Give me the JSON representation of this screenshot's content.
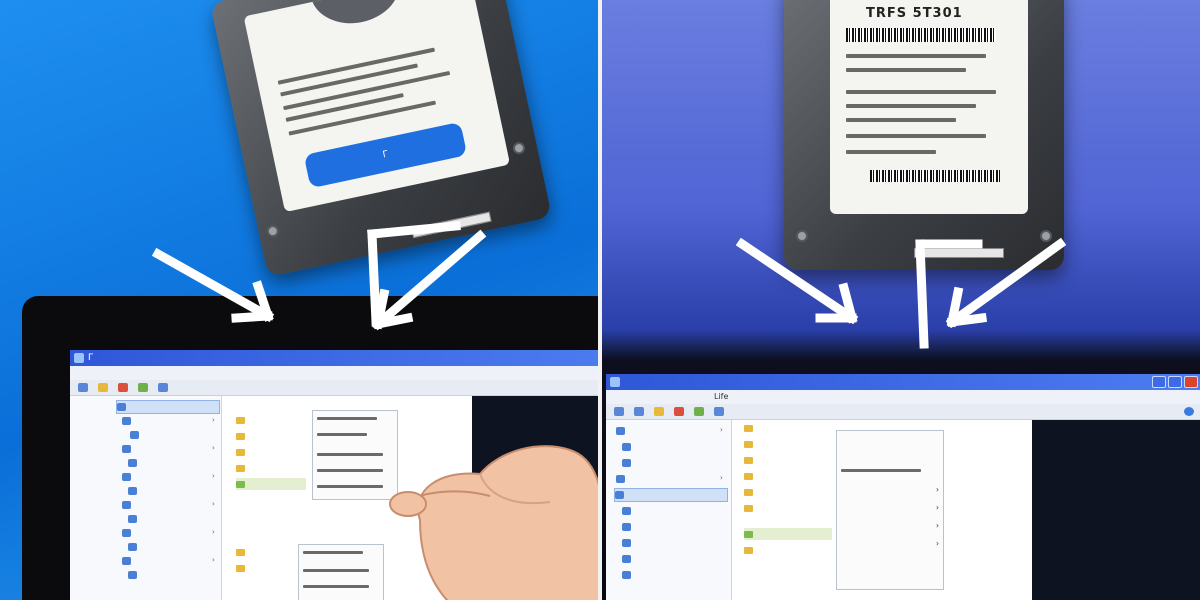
{
  "left_panel": {
    "drive": {
      "label_title": "",
      "button_text": "Γ"
    },
    "window": {
      "title": "Γ",
      "menu": [
        "",
        "",
        "",
        "",
        "",
        ""
      ],
      "nav_items": [
        "",
        "",
        "",
        "",
        "",
        "",
        "",
        "",
        "",
        "",
        "",
        "",
        ""
      ],
      "folders": [
        "",
        "",
        "",
        "",
        "",
        "",
        ""
      ],
      "props": []
    }
  },
  "right_panel": {
    "drive": {
      "label_title": "TRFS 5T301"
    },
    "window": {
      "title": "",
      "menu": [
        "",
        "",
        "",
        "",
        "",
        "",
        "",
        "Life"
      ],
      "nav_items": [
        "",
        "",
        "",
        "",
        "",
        "",
        "",
        "",
        "",
        ""
      ],
      "folders": [
        "",
        "",
        "",
        "",
        "",
        "",
        "",
        ""
      ],
      "props": [
        "",
        "",
        "",
        "",
        "",
        ""
      ]
    }
  },
  "colors": {
    "left_background": "#1e8ff0",
    "right_background": "#5064d4",
    "titlebar": "#2f57d8",
    "drive_body": "#3b3e42",
    "label": "#f4f4f0"
  }
}
